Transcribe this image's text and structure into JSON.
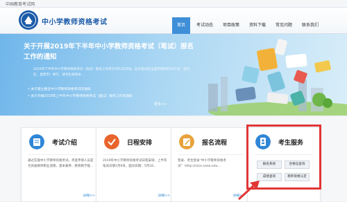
{
  "topbar": {
    "text": "中国教育考试网"
  },
  "header": {
    "title": "中小学教师资格考试"
  },
  "nav": {
    "items": [
      "首页",
      "考试动态",
      "项目政策",
      "资料下载",
      "常见问题",
      "联系我们"
    ],
    "active": 0
  },
  "hero": {
    "title": "关于开展2019年下半年中小学教师资格考试（笔试）报名工作的通知",
    "desc": "2019年下半年中小学教师资格考试（笔试）报名工作将于9月3日开始，此次笔试在全国范围内的28个省（自治区、直辖市）举行，请考生按照本...",
    "links": [
      "• 关于建立健全中小学教师资格考试的通知",
      "• 关于开展2019年上半年中小学教师资格考试（面试）报名工作的通知"
    ],
    "more": "更多>>"
  },
  "cards": [
    {
      "title": "考试介绍",
      "desc": "通过实施中小学教师资格考试，考查申请人员是否具备教师职业道德、基本素养、教育教学能...",
      "more": "详细>>",
      "icon": "book-icon",
      "color": "#2f86d6"
    },
    {
      "title": "日程安排",
      "desc": "2019年中小学教师资格考试日程安排：上半年笔试日期1月9日，面试日期：5月18...",
      "more": "详细>>",
      "icon": "check-icon",
      "color": "#e8642c"
    },
    {
      "title": "报名流程",
      "desc": "登录、考生登录“中小学教师资格考试”（http://ntce.neea.edu...",
      "more": "详细>>",
      "icon": "pencil-icon",
      "color": "#e8a23c"
    },
    {
      "title": "考生服务",
      "icon": "id-card-icon",
      "color": "#2f86d6"
    }
  ],
  "services": [
    "报名系统",
    "合格证查询",
    "成绩查询",
    "教师资格认定"
  ],
  "colors": {
    "accent": "#3f8fd8",
    "highlight": "#e23535"
  }
}
